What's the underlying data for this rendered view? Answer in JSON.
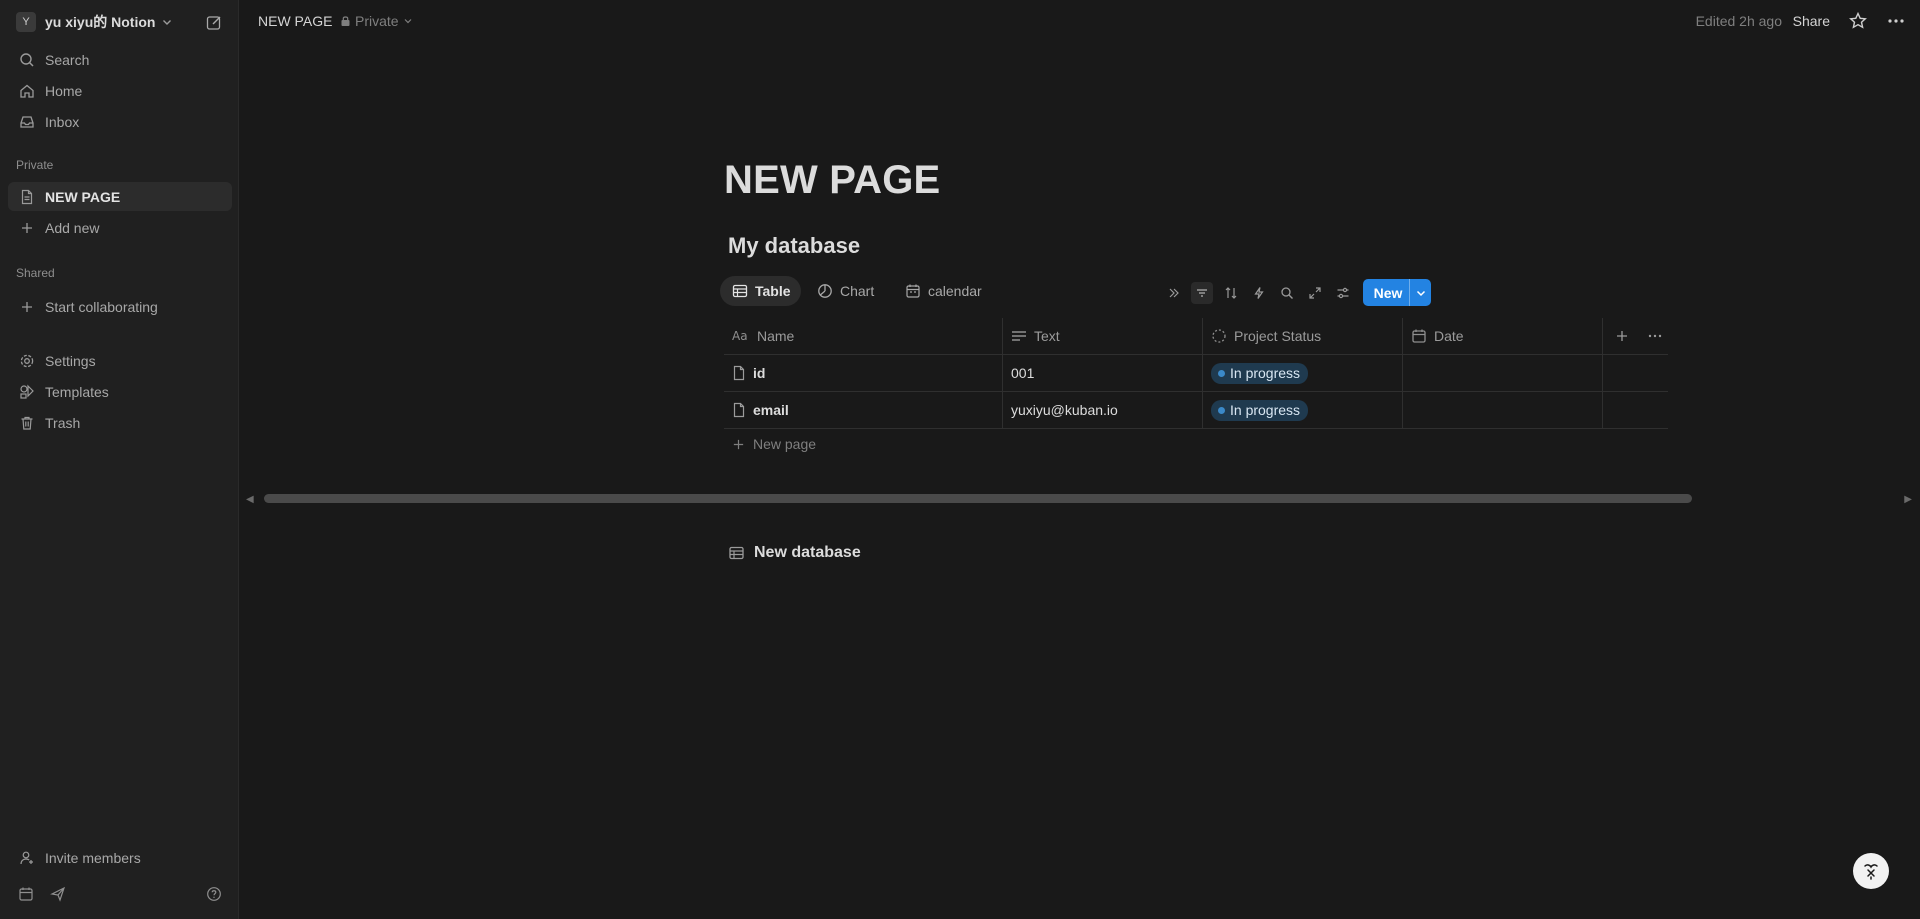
{
  "workspace": {
    "avatar": "Y",
    "name": "yu xiyu的 Notion"
  },
  "sidebar": {
    "top_items": [
      {
        "label": "Search",
        "icon": "search-icon"
      },
      {
        "label": "Home",
        "icon": "home-icon"
      },
      {
        "label": "Inbox",
        "icon": "inbox-icon"
      }
    ],
    "private_label": "Private",
    "private_items": [
      {
        "label": "NEW PAGE",
        "icon": "page-icon"
      },
      {
        "label": "Add new",
        "icon": "plus-icon"
      }
    ],
    "shared_label": "Shared",
    "shared_items": [
      {
        "label": "Start collaborating",
        "icon": "plus-icon"
      }
    ],
    "bottom_items": [
      {
        "label": "Settings",
        "icon": "gear-icon"
      },
      {
        "label": "Templates",
        "icon": "templates-icon"
      },
      {
        "label": "Trash",
        "icon": "trash-icon"
      }
    ],
    "invite_label": "Invite members"
  },
  "topbar": {
    "title": "NEW PAGE",
    "privacy": "Private",
    "edited": "Edited 2h ago",
    "share": "Share"
  },
  "page": {
    "title": "NEW PAGE",
    "database_title": "My database",
    "views": [
      {
        "label": "Table",
        "icon": "table-icon"
      },
      {
        "label": "Chart",
        "icon": "chart-icon"
      },
      {
        "label": "calendar",
        "icon": "calendar-icon"
      }
    ],
    "new_button": "New",
    "columns": [
      {
        "label": "Name",
        "icon": "title-icon"
      },
      {
        "label": "Text",
        "icon": "text-lines-icon"
      },
      {
        "label": "Project Status",
        "icon": "status-icon"
      },
      {
        "label": "Date",
        "icon": "calendar-icon"
      }
    ],
    "rows": [
      {
        "name": "id",
        "text": "001",
        "status": "In progress",
        "date": ""
      },
      {
        "name": "email",
        "text": "yuxiyu@kuban.io",
        "status": "In progress",
        "date": ""
      }
    ],
    "new_page_label": "New page",
    "second_database": "New database"
  },
  "colors": {
    "accent": "#2383e2",
    "status_bg": "#1f3a4f",
    "status_dot": "#3b89c8",
    "background": "#191919",
    "sidebar": "#202020"
  }
}
